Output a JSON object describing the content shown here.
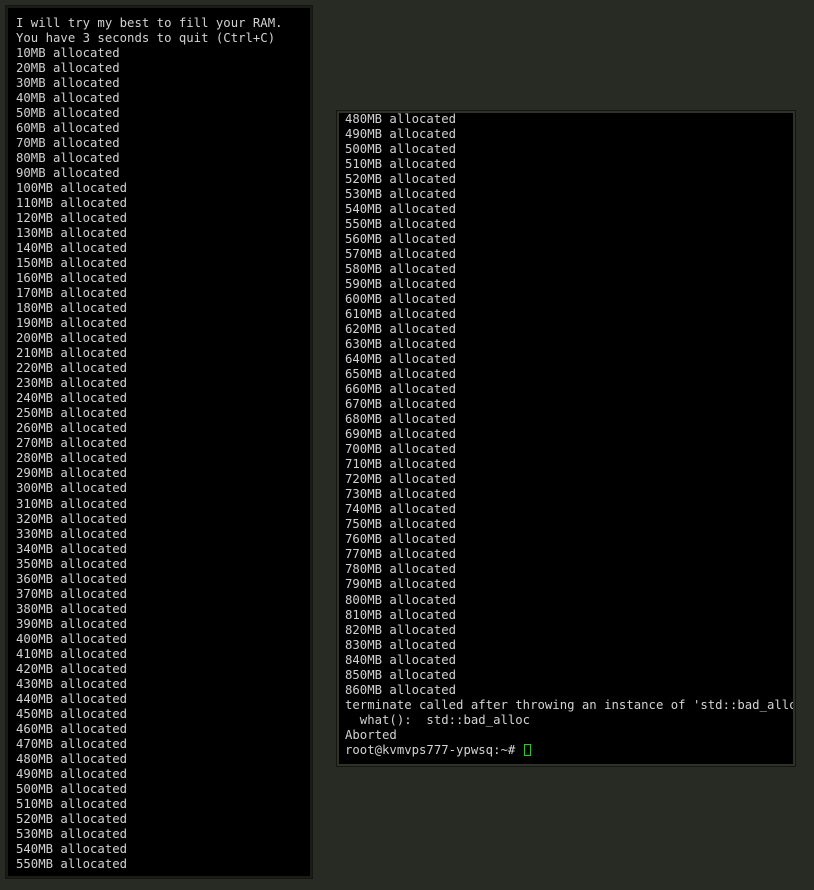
{
  "desktop": {
    "background_color": "#282a24"
  },
  "terminals": [
    {
      "id": "left-terminal",
      "name": "memory-hog-terminal-left",
      "background_color": "#000000",
      "text_color": "#d2d2d2",
      "lines": [
        "I will try my best to fill your RAM.",
        "You have 3 seconds to quit (Ctrl+C)",
        "10MB allocated",
        "20MB allocated",
        "30MB allocated",
        "40MB allocated",
        "50MB allocated",
        "60MB allocated",
        "70MB allocated",
        "80MB allocated",
        "90MB allocated",
        "100MB allocated",
        "110MB allocated",
        "120MB allocated",
        "130MB allocated",
        "140MB allocated",
        "150MB allocated",
        "160MB allocated",
        "170MB allocated",
        "180MB allocated",
        "190MB allocated",
        "200MB allocated",
        "210MB allocated",
        "220MB allocated",
        "230MB allocated",
        "240MB allocated",
        "250MB allocated",
        "260MB allocated",
        "270MB allocated",
        "280MB allocated",
        "290MB allocated",
        "300MB allocated",
        "310MB allocated",
        "320MB allocated",
        "330MB allocated",
        "340MB allocated",
        "350MB allocated",
        "360MB allocated",
        "370MB allocated",
        "380MB allocated",
        "390MB allocated",
        "400MB allocated",
        "410MB allocated",
        "420MB allocated",
        "430MB allocated",
        "440MB allocated",
        "450MB allocated",
        "460MB allocated",
        "470MB allocated",
        "480MB allocated",
        "490MB allocated",
        "500MB allocated",
        "510MB allocated",
        "520MB allocated",
        "530MB allocated",
        "540MB allocated",
        "550MB allocated"
      ]
    },
    {
      "id": "right-terminal",
      "name": "memory-hog-terminal-right",
      "background_color": "#000000",
      "text_color": "#d2d2d2",
      "lines": [
        "480MB allocated",
        "490MB allocated",
        "500MB allocated",
        "510MB allocated",
        "520MB allocated",
        "530MB allocated",
        "540MB allocated",
        "550MB allocated",
        "560MB allocated",
        "570MB allocated",
        "580MB allocated",
        "590MB allocated",
        "600MB allocated",
        "610MB allocated",
        "620MB allocated",
        "630MB allocated",
        "640MB allocated",
        "650MB allocated",
        "660MB allocated",
        "670MB allocated",
        "680MB allocated",
        "690MB allocated",
        "700MB allocated",
        "710MB allocated",
        "720MB allocated",
        "730MB allocated",
        "740MB allocated",
        "750MB allocated",
        "760MB allocated",
        "770MB allocated",
        "780MB allocated",
        "790MB allocated",
        "800MB allocated",
        "810MB allocated",
        "820MB allocated",
        "830MB allocated",
        "840MB allocated",
        "850MB allocated",
        "860MB allocated",
        "terminate called after throwing an instance of 'std::bad_alloc'",
        "  what():  std::bad_alloc",
        "Aborted"
      ],
      "prompt": {
        "text": "root@kvmvps777-ypwsq:~#",
        "user": "root",
        "host": "kvmvps777-ypwsq",
        "path": "~",
        "symbol": "#",
        "cursor_color": "#22cc22",
        "cursor_style": "hollow-block"
      }
    }
  ]
}
